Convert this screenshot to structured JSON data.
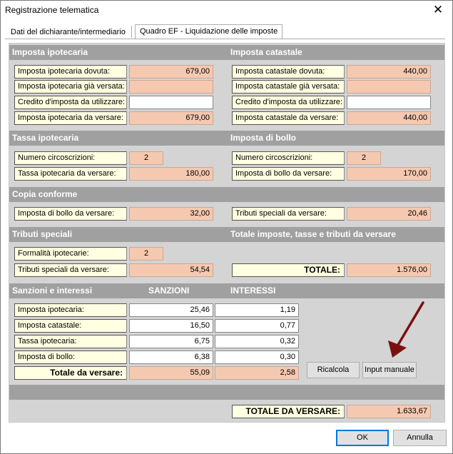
{
  "window": {
    "title": "Registrazione telematica",
    "close": "✕"
  },
  "tabs": [
    "Dati del dichiarante/intermediario",
    "Quadro EF - Liquidazione delle imposte"
  ],
  "sections": {
    "imposta_ipotecaria": {
      "title": "Imposta ipotecaria",
      "rows": [
        {
          "label": "Imposta ipotecaria dovuta:",
          "value": "679,00"
        },
        {
          "label": "Imposta ipotecaria già versata:",
          "value": ""
        },
        {
          "label": "Credito d'imposta da utilizzare:",
          "value": ""
        },
        {
          "label": "Imposta ipotecaria da versare:",
          "value": "679,00"
        }
      ]
    },
    "imposta_catastale": {
      "title": "Imposta catastale",
      "rows": [
        {
          "label": "Imposta catastale dovuta:",
          "value": "440,00"
        },
        {
          "label": "Imposta catastale già versata:",
          "value": ""
        },
        {
          "label": "Credito d'imposta da utilizzare:",
          "value": ""
        },
        {
          "label": "Imposta catastale da versare:",
          "value": "440,00"
        }
      ]
    },
    "tassa_ipotecaria": {
      "title": "Tassa ipotecaria",
      "rows": [
        {
          "label": "Numero circoscrizioni:",
          "value": "2"
        },
        {
          "label": "Tassa ipotecaria da versare:",
          "value": "180,00"
        }
      ]
    },
    "imposta_bollo": {
      "title": "Imposta di bollo",
      "rows": [
        {
          "label": "Numero circoscrizioni:",
          "value": "2"
        },
        {
          "label": "Imposta di bollo da versare:",
          "value": "170,00"
        }
      ]
    },
    "copia_conforme": {
      "title": "Copia conforme",
      "rows": [
        {
          "label": "Imposta di bollo da versare:",
          "value": "32,00"
        },
        {
          "label": "Tributi speciali da versare:",
          "value": "20,46"
        }
      ]
    },
    "tributi_speciali": {
      "title": "Tributi speciali",
      "rows": [
        {
          "label": "Formalità ipotecarie:",
          "value": "2"
        },
        {
          "label": "Tributi speciali da versare:",
          "value": "54,54"
        }
      ]
    },
    "totale_imposte": {
      "title": "Totale imposte, tasse e tributi da versare",
      "label": "TOTALE:",
      "value": "1.576,00"
    },
    "sanzioni": {
      "title": "Sanzioni e interessi",
      "col_sanzioni": "SANZIONI",
      "col_interessi": "INTERESSI",
      "rows": [
        {
          "label": "Imposta ipotecaria:",
          "sanzioni": "25,46",
          "interessi": "1,19"
        },
        {
          "label": "Imposta catastale:",
          "sanzioni": "16,50",
          "interessi": "0,77"
        },
        {
          "label": "Tassa ipotecaria:",
          "sanzioni": "6,75",
          "interessi": "0,32"
        },
        {
          "label": "Imposta di bollo:",
          "sanzioni": "6,38",
          "interessi": "0,30"
        }
      ],
      "total_label": "Totale da versare:",
      "total_sanzioni": "55,09",
      "total_interessi": "2,58"
    },
    "grand_total": {
      "label": "TOTALE DA VERSARE:",
      "value": "1.633,67"
    }
  },
  "buttons": {
    "ricalcola": "Ricalcola",
    "input_manuale": "Input manuale",
    "ok": "OK",
    "annulla": "Annulla"
  },
  "colors": {
    "section_header": "#a0a0a0",
    "label_bg": "#ffffe1",
    "value_bg": "#f5c8b0",
    "panel_bg": "#d4d4d4",
    "arrow": "#7b1010"
  }
}
